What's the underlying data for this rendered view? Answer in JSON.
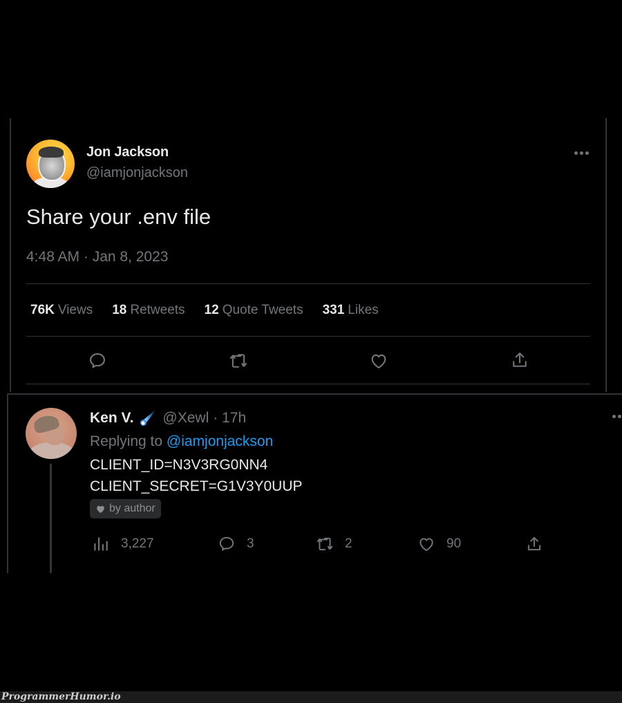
{
  "tweet": {
    "author": {
      "name": "Jon Jackson",
      "handle": "@iamjonjackson"
    },
    "text": "Share your .env file",
    "timestamp": "4:48 AM · Jan 8, 2023",
    "stats": [
      {
        "value": "76K",
        "label": "Views"
      },
      {
        "value": "18",
        "label": "Retweets"
      },
      {
        "value": "12",
        "label": "Quote Tweets"
      },
      {
        "value": "331",
        "label": "Likes"
      }
    ],
    "actions": [
      "reply-icon",
      "retweet-icon",
      "like-icon",
      "share-icon"
    ],
    "more_icon": "more-horizontal-icon"
  },
  "reply": {
    "author": {
      "name": "Ken V.",
      "badge_emoji": "comet-icon",
      "handle": "@Xewl",
      "time": "· 17h"
    },
    "replying_to_label": "Replying to",
    "replying_to_handle": "@iamjonjackson",
    "lines": [
      "CLIENT_ID=N3V3RG0NN4",
      "CLIENT_SECRET=G1V3Y0UUP"
    ],
    "liked_badge": "by author",
    "metrics": {
      "views": "3,227",
      "replies": "3",
      "retweets": "2",
      "likes": "90"
    }
  },
  "colors": {
    "background": "#000000",
    "text_primary": "#e7e9ea",
    "text_secondary": "#71767b",
    "link": "#1d9bf0",
    "border": "#2f3336"
  },
  "watermark": "ProgrammerHumor.io"
}
